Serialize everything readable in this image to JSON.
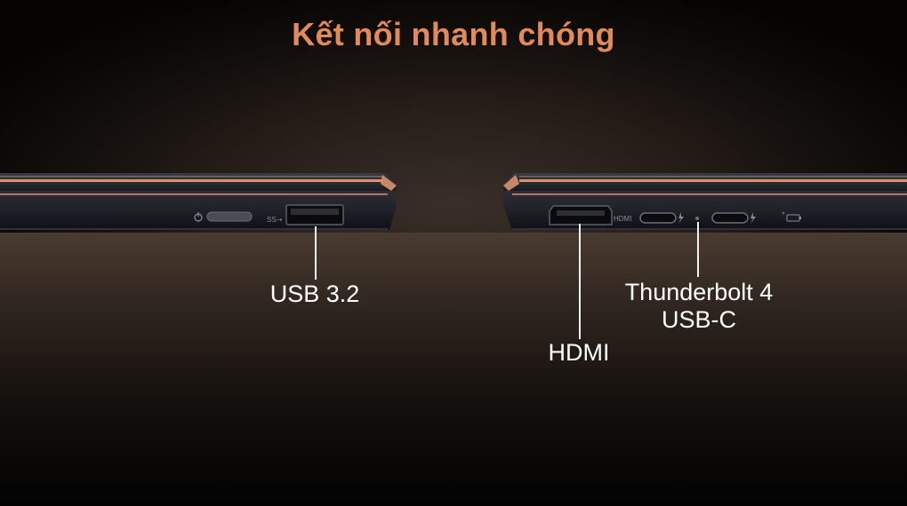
{
  "headline": "Kết nối nhanh chóng",
  "left_side": {
    "ports": [
      {
        "icon": "usb-3.2-port",
        "marking": "SS",
        "label": "USB 3.2"
      }
    ],
    "icons": [
      "power-button",
      "usb-3.2-port"
    ]
  },
  "right_side": {
    "ports": [
      {
        "icon": "hdmi-port",
        "marking": "HDMI",
        "label": "HDMI"
      },
      {
        "icon": "thunderbolt-usb-c-port",
        "label_line1": "Thunderbolt 4",
        "label_line2": "USB-C"
      }
    ],
    "icons": [
      "hdmi-port",
      "thunderbolt-usb-c-port",
      "thunderbolt-usb-c-port",
      "status-led",
      "battery-indicator"
    ]
  },
  "colors": {
    "headline": "#e28a5a",
    "chassis": "#23242c",
    "copper_trim": "#d9926b",
    "label": "#ffffff"
  }
}
